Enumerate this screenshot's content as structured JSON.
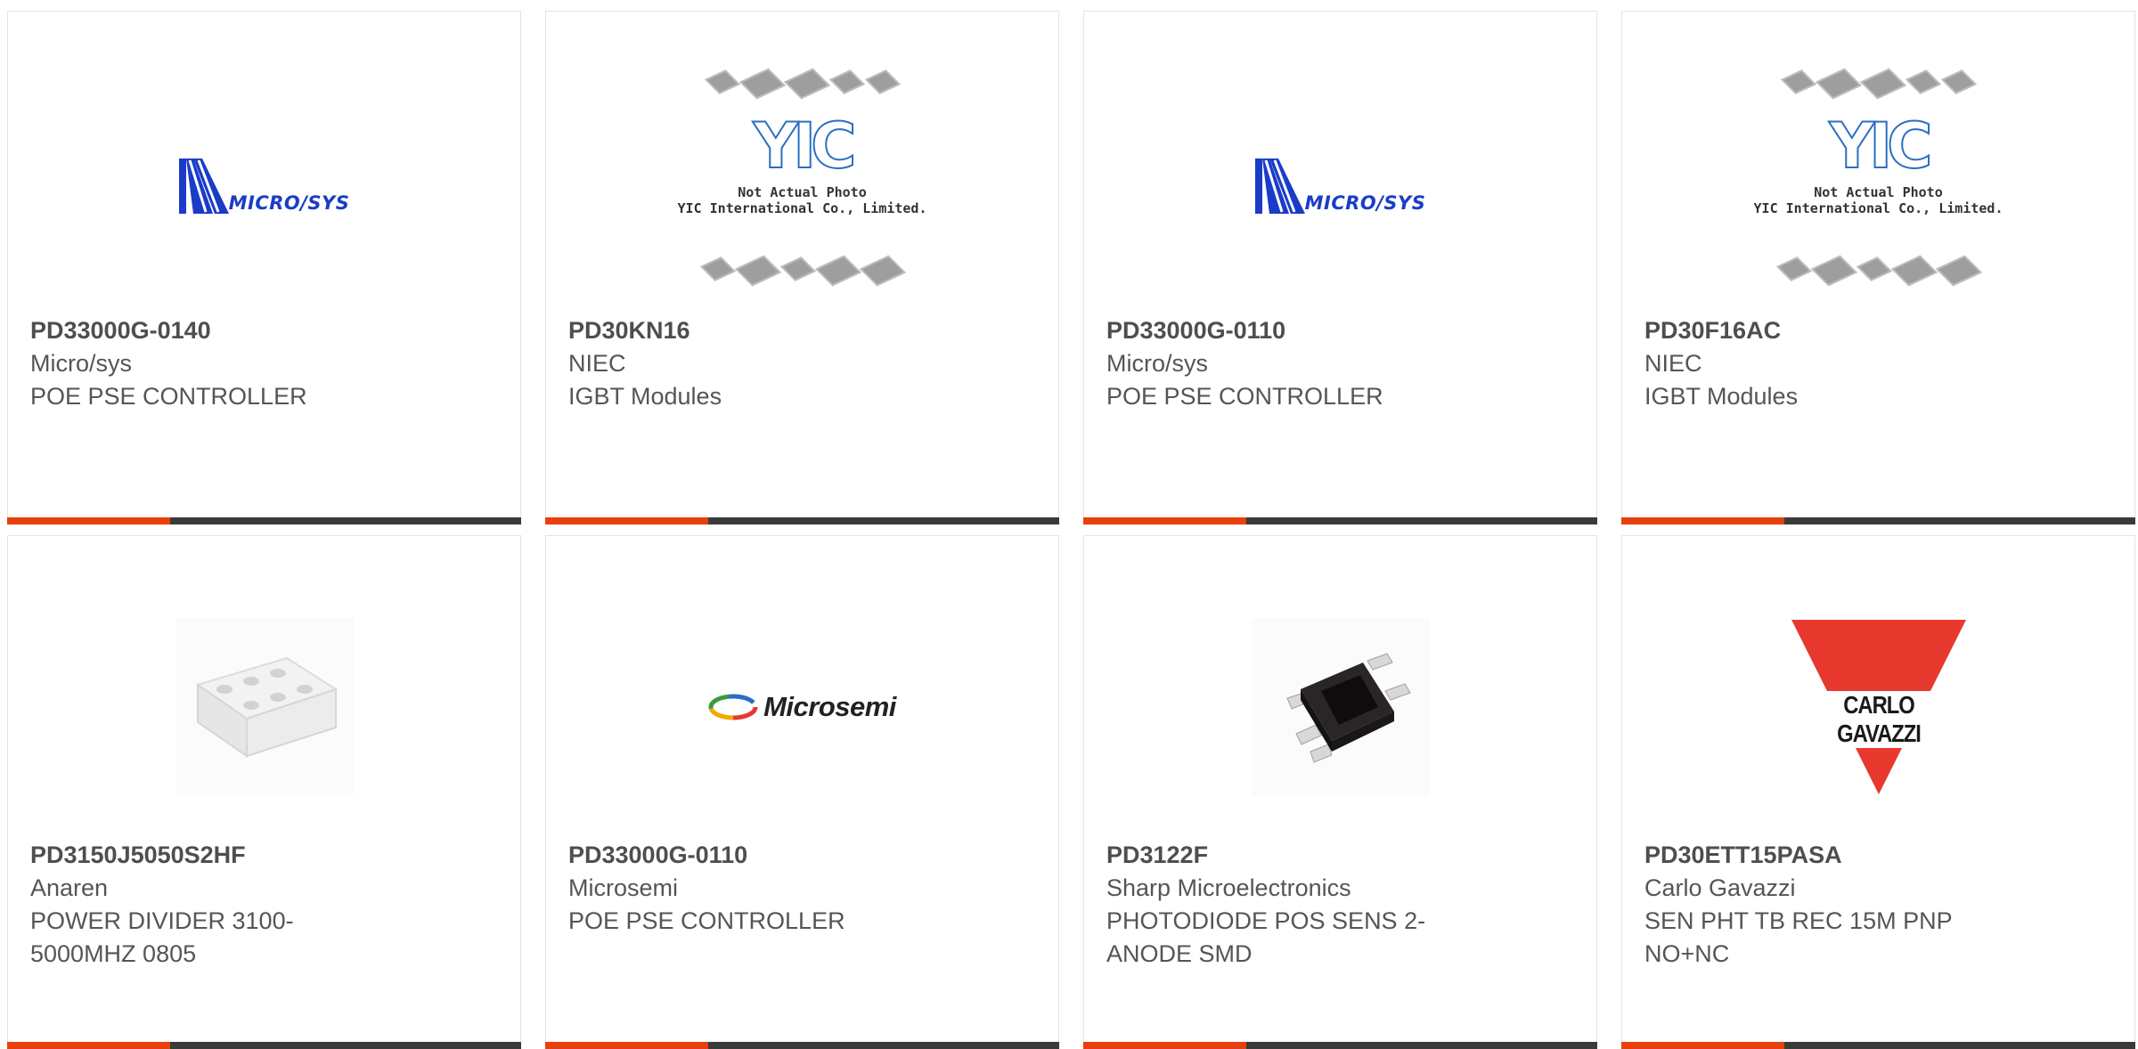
{
  "colors": {
    "accent": "#e8400c",
    "bar": "#3a3a3a",
    "text": "#555555",
    "microsys_blue": "#1a3cc8",
    "yic_blue": "#2a6fc0",
    "gavazzi_red": "#e8392f"
  },
  "products": [
    {
      "part_number": "PD33000G-0140",
      "manufacturer": "Micro/sys",
      "description": "POE PSE CONTROLLER",
      "image": "micro-sys-logo",
      "logo_text": "MICRO/SYS"
    },
    {
      "part_number": "PD30KN16",
      "manufacturer": "NIEC",
      "description": "IGBT Modules",
      "image": "yic-placeholder",
      "logo_text": "YIC",
      "caption_line1": "Not Actual Photo",
      "caption_line2": "YIC International Co., Limited."
    },
    {
      "part_number": "PD33000G-0110",
      "manufacturer": "Micro/sys",
      "description": "POE PSE CONTROLLER",
      "image": "micro-sys-logo",
      "logo_text": "MICRO/SYS"
    },
    {
      "part_number": "PD30F16AC",
      "manufacturer": "NIEC",
      "description": "IGBT Modules",
      "image": "yic-placeholder",
      "logo_text": "YIC",
      "caption_line1": "Not Actual Photo",
      "caption_line2": "YIC International Co., Limited."
    },
    {
      "part_number": "PD3150J5050S2HF",
      "manufacturer": "Anaren",
      "description": "POWER DIVIDER 3100-\n5000MHZ 0805",
      "image": "smd-component-photo"
    },
    {
      "part_number": "PD33000G-0110",
      "manufacturer": "Microsemi",
      "description": "POE PSE CONTROLLER",
      "image": "microsemi-logo",
      "logo_text": "Microsemi"
    },
    {
      "part_number": "PD3122F",
      "manufacturer": "Sharp Microelectronics",
      "description": "PHOTODIODE POS SENS 2-\nANODE SMD",
      "image": "photodiode-photo"
    },
    {
      "part_number": "PD30ETT15PASA",
      "manufacturer": "Carlo Gavazzi",
      "description": "SEN PHT TB REC 15M PNP\nNO+NC",
      "image": "carlo-gavazzi-logo",
      "logo_text": "CARLO GAVAZZI"
    }
  ]
}
